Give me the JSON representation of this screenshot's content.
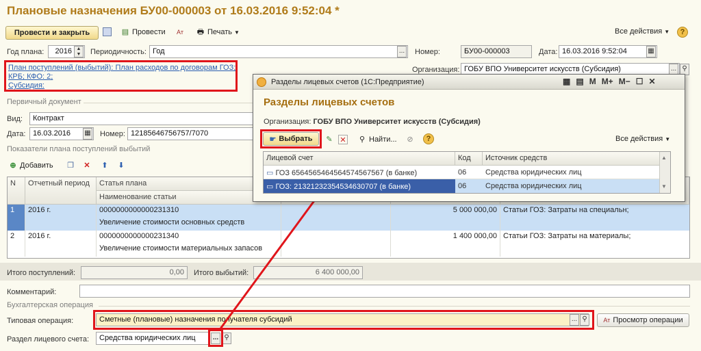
{
  "doc": {
    "title": "Плановые назначения БУ00-000003 от 16.03.2016 9:52:04 *"
  },
  "toolbar": {
    "post_close": "Провести и закрыть",
    "post": "Провести",
    "print": "Печать",
    "all_actions": "Все действия",
    "help": "?"
  },
  "header": {
    "year_label": "Год плана:",
    "year_value": "2016",
    "period_label": "Периодичность:",
    "period_value": "Год",
    "number_label": "Номер:",
    "number_value": "БУ00-000003",
    "date_label": "Дата:",
    "date_value": "16.03.2016  9:52:04",
    "org_label": "Организация:",
    "org_value": "ГОБУ ВПО Университет искусств (Субсидия)"
  },
  "links": {
    "line1": "План поступлений (выбытий): План расходов по договорам ГОЗ;",
    "line2": "КРБ; КФО: 2;",
    "line3": "Субсидия:"
  },
  "primary": {
    "section": "Первичный документ",
    "kind_label": "Вид:",
    "kind_value": "Контракт",
    "date_label": "Дата:",
    "date_value": "16.03.2016",
    "number_label": "Номер:",
    "number_value": "12185646756757/7070"
  },
  "plan": {
    "section": "Показатели плана поступлений выбытий",
    "add": "Добавить",
    "columns": {
      "n": "N",
      "period": "Отчетный период",
      "article": "Статья плана",
      "article_name": "Наименование статьи"
    },
    "rows": [
      {
        "n": "1",
        "period": "2016 г.",
        "code": "0000000000000231310",
        "name": "Увеличение стоимости основных средств",
        "amount": "5 000 000,00",
        "source": "Статьи ГОЗ: Затраты на специальн;"
      },
      {
        "n": "2",
        "period": "2016 г.",
        "code": "0000000000000231340",
        "name": "Увеличение стоимости материальных запасов",
        "amount": "1 400 000,00",
        "source": "Статьи ГОЗ: Затраты на материалы;"
      }
    ]
  },
  "totals": {
    "in_label": "Итого поступлений:",
    "in_value": "0,00",
    "out_label": "Итого выбытий:",
    "out_value": "6 400 000,00"
  },
  "comment": {
    "label": "Комментарий:"
  },
  "accounting": {
    "section": "Бухгалтерская операция",
    "op_label": "Типовая операция:",
    "op_value": "Сметные (плановые) назначения получателя субсидий",
    "view_ops": "Просмотр операции",
    "acc_label": "Раздел лицевого счета:",
    "acc_value": "Средства юридических лиц"
  },
  "modal": {
    "window_title": "Разделы лицевых счетов  (1С:Предприятие)",
    "heading": "Разделы лицевых счетов",
    "org_label": "Организация:",
    "org_value": "ГОБУ ВПО Университет искусств (Субсидия)",
    "select": "Выбрать",
    "find": "Найти...",
    "all_actions": "Все действия",
    "wbtn_m": "M",
    "wbtn_mplus": "M+",
    "wbtn_mminus": "M−",
    "columns": {
      "account": "Лицевой счет",
      "code": "Код",
      "source": "Источник средств"
    },
    "rows": [
      {
        "account": "ГОЗ 6564565464564574567567 (в банке)",
        "code": "06",
        "source": "Средства юридических лиц"
      },
      {
        "account": "ГОЗ: 21321232354534630707 (в банке)",
        "code": "06",
        "source": "Средства юридических лиц"
      }
    ]
  },
  "colors": {
    "title": "#b07b1a",
    "highlight_red": "#e0151b",
    "selected_row": "#3a5fa8",
    "grid_selected": "#c9dff5"
  }
}
